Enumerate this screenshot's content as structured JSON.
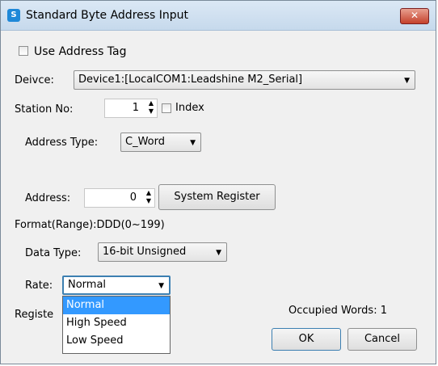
{
  "window": {
    "title": "Standard Byte Address Input",
    "close_symbol": "✕",
    "app_icon_glyph": "S"
  },
  "use_address_tag": {
    "label": "Use Address Tag",
    "checked": false
  },
  "device": {
    "label": "Deivce:",
    "value": "Device1:[LocalCOM1:Leadshine M2_Serial]"
  },
  "station": {
    "label": "Station No:",
    "value": "1"
  },
  "index": {
    "label": "Index",
    "checked": false
  },
  "address_type": {
    "label": "Address Type:",
    "value": "C_Word"
  },
  "address": {
    "label": "Address:",
    "value": "0"
  },
  "system_register_button": "System Register",
  "format_text": "Format(Range):DDD(0~199)",
  "data_type": {
    "label": "Data Type:",
    "value": "16-bit Unsigned"
  },
  "rate": {
    "label": "Rate:",
    "value": "Normal",
    "options": [
      "Normal",
      "High Speed",
      "Low Speed"
    ]
  },
  "register_label_partial": "Registe",
  "occupied_words": "Occupied Words: 1",
  "ok_button": "OK",
  "cancel_button": "Cancel",
  "icons": {
    "dropdown": "▼",
    "spin_up": "▲",
    "spin_down": "▼"
  },
  "colors": {
    "titlebar": "#c6d9ec",
    "selection": "#3399ff",
    "close": "#c4412b"
  }
}
